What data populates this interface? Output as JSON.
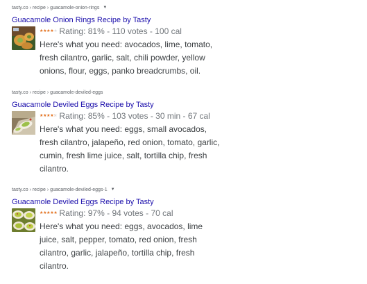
{
  "results": [
    {
      "breadcrumb": "tasty.co › recipe › guacamole-onion-rings",
      "title": "Guacamole Onion Rings Recipe by Tasty",
      "rating": 0.81,
      "star_color": "#e7711b",
      "meta": "Rating: 81% - 110 votes - 100 cal",
      "snippet": "Here's what you need: avocados, lime, tomato, fresh cilantro, garlic, salt, chili powder, yellow onions, flour, eggs, panko breadcrumbs, oil."
    },
    {
      "breadcrumb": "tasty.co › recipe › guacamole-deviled-eggs",
      "title": "Guacamole Deviled Eggs Recipe by Tasty",
      "rating": 0.85,
      "star_color": "#e7711b",
      "meta": "Rating: 85% - 103 votes - 30 min - 67 cal",
      "snippet": "Here's what you need: eggs, small avocados, fresh cilantro, jalapeño, red onion, tomato, garlic, cumin, fresh lime juice, salt, tortilla chip, fresh cilantro."
    },
    {
      "breadcrumb": "tasty.co › recipe › guacamole-deviled-eggs-1",
      "title": "Guacamole Deviled Eggs Recipe by Tasty",
      "rating": 0.97,
      "star_color": "#e7711b",
      "meta": "Rating: 97% - 94 votes - 70 cal",
      "snippet": "Here's what you need: eggs, avocados, lime juice, salt, pepper, tomato, red onion, fresh cilantro, garlic, jalapeño, tortilla chip, fresh cilantro."
    }
  ]
}
